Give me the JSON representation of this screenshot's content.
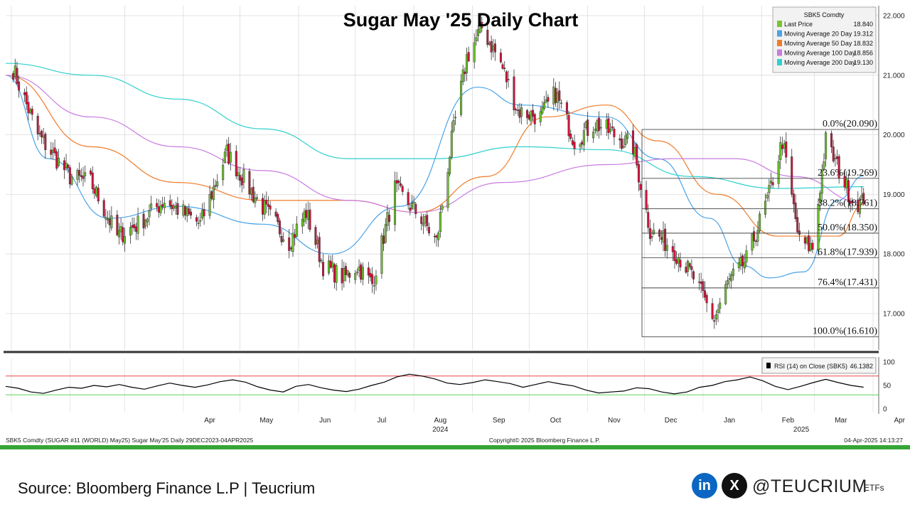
{
  "chart_data": [
    {
      "type": "candlestick",
      "title": "Sugar May '25 Daily Chart",
      "ylim": [
        16.6,
        22.2
      ],
      "yticks": [
        "22.000",
        "21.000",
        "20.000",
        "19.000",
        "18.000",
        "17.000"
      ],
      "x_months": [
        "Apr",
        "May",
        "Jun",
        "Jul",
        "Aug",
        "Sep",
        "Oct",
        "Nov",
        "Dec",
        "Jan",
        "Feb",
        "Mar",
        "Apr"
      ],
      "x_years": [
        "2024",
        "2025"
      ],
      "legend": {
        "header": "SBK5 Comdty",
        "items": [
          {
            "label": "Last Price",
            "value": "18.840",
            "color": "#7ac231"
          },
          {
            "label": "Moving Average 20 Day",
            "value": "19.312",
            "color": "#4aa3e8"
          },
          {
            "label": "Moving Average 50 Day",
            "value": "18.832",
            "color": "#f07c2a"
          },
          {
            "label": "Moving Average 100 Day",
            "value": "18.856",
            "color": "#c97be0"
          },
          {
            "label": "Moving Average 200 Day",
            "value": "19.130",
            "color": "#2fd0cf"
          }
        ]
      },
      "price_anchors": [
        {
          "date": "2024-01-02",
          "close": 21.1
        },
        {
          "date": "2024-01-15",
          "close": 20.0
        },
        {
          "date": "2024-02-01",
          "close": 19.3
        },
        {
          "date": "2024-02-12",
          "close": 19.2
        },
        {
          "date": "2024-02-26",
          "close": 18.3
        },
        {
          "date": "2024-03-08",
          "close": 18.5
        },
        {
          "date": "2024-03-22",
          "close": 18.9
        },
        {
          "date": "2024-04-10",
          "close": 18.5
        },
        {
          "date": "2024-04-24",
          "close": 19.7
        },
        {
          "date": "2024-05-08",
          "close": 19.0
        },
        {
          "date": "2024-05-27",
          "close": 18.2
        },
        {
          "date": "2024-06-05",
          "close": 18.7
        },
        {
          "date": "2024-06-14",
          "close": 17.8
        },
        {
          "date": "2024-06-25",
          "close": 17.6
        },
        {
          "date": "2024-07-02",
          "close": 17.8
        },
        {
          "date": "2024-07-10",
          "close": 17.5
        },
        {
          "date": "2024-07-22",
          "close": 19.1
        },
        {
          "date": "2024-08-05",
          "close": 18.6
        },
        {
          "date": "2024-08-13",
          "close": 18.2
        },
        {
          "date": "2024-08-21",
          "close": 19.9
        },
        {
          "date": "2024-08-29",
          "close": 21.3
        },
        {
          "date": "2024-09-06",
          "close": 21.8
        },
        {
          "date": "2024-09-16",
          "close": 21.2
        },
        {
          "date": "2024-09-25",
          "close": 20.4
        },
        {
          "date": "2024-10-07",
          "close": 20.3
        },
        {
          "date": "2024-10-15",
          "close": 20.7
        },
        {
          "date": "2024-10-25",
          "close": 19.9
        },
        {
          "date": "2024-11-05",
          "close": 20.2
        },
        {
          "date": "2024-11-15",
          "close": 20.0
        },
        {
          "date": "2024-11-25",
          "close": 19.8
        },
        {
          "date": "2024-12-04",
          "close": 18.4
        },
        {
          "date": "2024-12-16",
          "close": 18.1
        },
        {
          "date": "2024-12-27",
          "close": 17.6
        },
        {
          "date": "2025-01-07",
          "close": 16.9
        },
        {
          "date": "2025-01-14",
          "close": 17.5
        },
        {
          "date": "2025-01-24",
          "close": 17.9
        },
        {
          "date": "2025-02-05",
          "close": 19.0
        },
        {
          "date": "2025-02-12",
          "close": 19.9
        },
        {
          "date": "2025-02-21",
          "close": 18.2
        },
        {
          "date": "2025-02-28",
          "close": 18.1
        },
        {
          "date": "2025-03-07",
          "close": 19.9
        },
        {
          "date": "2025-03-14",
          "close": 19.4
        },
        {
          "date": "2025-03-21",
          "close": 18.9
        },
        {
          "date": "2025-03-27",
          "close": 18.84
        }
      ],
      "moving_averages": {
        "ma20": [
          [
            0,
            21.0
          ],
          [
            0.05,
            19.6
          ],
          [
            0.12,
            18.6
          ],
          [
            0.2,
            18.8
          ],
          [
            0.3,
            18.5
          ],
          [
            0.38,
            18.0
          ],
          [
            0.46,
            18.8
          ],
          [
            0.55,
            20.8
          ],
          [
            0.6,
            20.5
          ],
          [
            0.7,
            20.3
          ],
          [
            0.76,
            19.6
          ],
          [
            0.82,
            18.6
          ],
          [
            0.86,
            17.8
          ],
          [
            0.89,
            17.6
          ],
          [
            0.93,
            17.7
          ],
          [
            0.97,
            18.9
          ],
          [
            1.0,
            19.31
          ]
        ],
        "ma50": [
          [
            0,
            21.0
          ],
          [
            0.1,
            19.8
          ],
          [
            0.2,
            19.2
          ],
          [
            0.3,
            18.9
          ],
          [
            0.4,
            18.9
          ],
          [
            0.48,
            18.7
          ],
          [
            0.56,
            19.3
          ],
          [
            0.63,
            20.3
          ],
          [
            0.7,
            20.5
          ],
          [
            0.76,
            19.9
          ],
          [
            0.83,
            19.0
          ],
          [
            0.9,
            18.3
          ],
          [
            0.97,
            18.3
          ],
          [
            1.0,
            18.83
          ]
        ],
        "ma100": [
          [
            0,
            21.0
          ],
          [
            0.1,
            20.3
          ],
          [
            0.2,
            19.8
          ],
          [
            0.3,
            19.4
          ],
          [
            0.4,
            18.9
          ],
          [
            0.48,
            18.7
          ],
          [
            0.58,
            19.2
          ],
          [
            0.7,
            19.5
          ],
          [
            0.78,
            19.6
          ],
          [
            0.85,
            19.6
          ],
          [
            0.92,
            19.3
          ],
          [
            1.0,
            18.86
          ]
        ],
        "ma200": [
          [
            0,
            21.2
          ],
          [
            0.1,
            21.0
          ],
          [
            0.2,
            20.6
          ],
          [
            0.3,
            20.1
          ],
          [
            0.4,
            19.6
          ],
          [
            0.5,
            19.6
          ],
          [
            0.6,
            19.8
          ],
          [
            0.7,
            19.75
          ],
          [
            0.8,
            19.3
          ],
          [
            0.9,
            19.1
          ],
          [
            1.0,
            19.13
          ]
        ]
      },
      "fibonacci": {
        "high": 20.09,
        "low": 16.61,
        "levels": [
          {
            "label": "0.0%(20.090)",
            "value": 20.09
          },
          {
            "label": "23.6%(19.269)",
            "value": 19.269
          },
          {
            "label": "38.2%(18.761)",
            "value": 18.761
          },
          {
            "label": "50.0%(18.350)",
            "value": 18.35
          },
          {
            "label": "61.8%(17.939)",
            "value": 17.939
          },
          {
            "label": "76.4%(17.431)",
            "value": 17.431
          },
          {
            "label": "100.0%(16.610)",
            "value": 16.61
          }
        ]
      }
    },
    {
      "type": "line",
      "legend": {
        "label": "RSI (14)  on Close (SBK5)",
        "value": "46.1382"
      },
      "ylim": [
        0,
        100
      ],
      "yticks": [
        "100",
        "50",
        "0"
      ],
      "overbought": 70,
      "oversold": 30,
      "values": [
        48,
        44,
        36,
        33,
        40,
        46,
        44,
        50,
        47,
        52,
        46,
        42,
        49,
        55,
        50,
        46,
        51,
        58,
        62,
        57,
        47,
        40,
        36,
        48,
        52,
        45,
        40,
        37,
        42,
        50,
        57,
        68,
        74,
        70,
        64,
        55,
        52,
        56,
        62,
        58,
        54,
        46,
        52,
        58,
        53,
        49,
        40,
        34,
        36,
        38,
        45,
        43,
        36,
        32,
        36,
        46,
        50,
        58,
        62,
        68,
        60,
        48,
        41,
        48,
        56,
        63,
        56,
        50,
        46.14
      ]
    }
  ],
  "footer": {
    "meta_left": "SBK5 Comdty (SUGAR #11 (WORLD) May25) Sugar May'25  Daily 29DEC2023-04APR2025",
    "meta_center": "Copyright© 2025 Bloomberg Finance L.P.",
    "meta_right": "04-Apr-2025 14:13:27",
    "source": "Source: Bloomberg Finance L.P | Teucrium",
    "linkedin_icon_text": "in",
    "x_icon_text": "X",
    "handle": "@TEUCRIUM",
    "brand_suffix": "ETFs"
  },
  "colors": {
    "up": "#6cc52a",
    "down": "#d6123a",
    "rsi_line": "#000000",
    "overbought": "#e54848",
    "oversold": "#5fd35f",
    "divider": "#36a536"
  }
}
